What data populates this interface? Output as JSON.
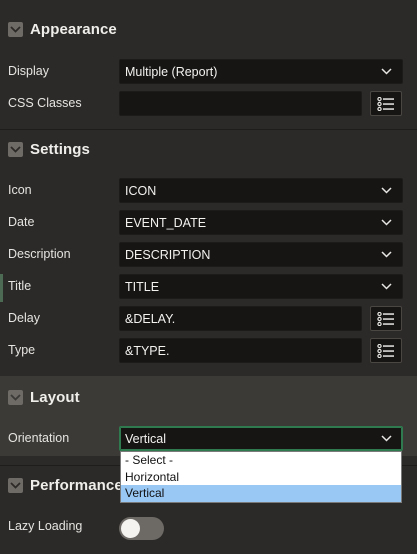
{
  "sections": {
    "appearance": {
      "title": "Appearance"
    },
    "settings": {
      "title": "Settings"
    },
    "layout": {
      "title": "Layout"
    },
    "performance": {
      "title": "Performance"
    }
  },
  "appearance": {
    "display": {
      "label": "Display",
      "value": "Multiple (Report)"
    },
    "css_classes": {
      "label": "CSS Classes",
      "value": ""
    }
  },
  "settings": {
    "icon": {
      "label": "Icon",
      "value": "ICON"
    },
    "date": {
      "label": "Date",
      "value": "EVENT_DATE"
    },
    "description": {
      "label": "Description",
      "value": "DESCRIPTION"
    },
    "title": {
      "label": "Title",
      "value": "TITLE"
    },
    "delay": {
      "label": "Delay",
      "value": "&DELAY."
    },
    "type": {
      "label": "Type",
      "value": "&TYPE."
    }
  },
  "layout": {
    "orientation": {
      "label": "Orientation",
      "value": "Vertical",
      "options": [
        "- Select -",
        "Horizontal",
        "Vertical"
      ],
      "selected_index": 2
    }
  },
  "performance": {
    "lazy_loading": {
      "label": "Lazy Loading",
      "enabled": false
    }
  },
  "colors": {
    "panel_bg": "#2c2a28",
    "field_bg": "#161514",
    "focus_border": "#2f7a4f",
    "option_highlight": "#99c8f5"
  },
  "icons": {
    "section_toggle": "chevron-down-icon",
    "select_arrow": "chevron-down-icon",
    "list_button": "list-icon"
  }
}
